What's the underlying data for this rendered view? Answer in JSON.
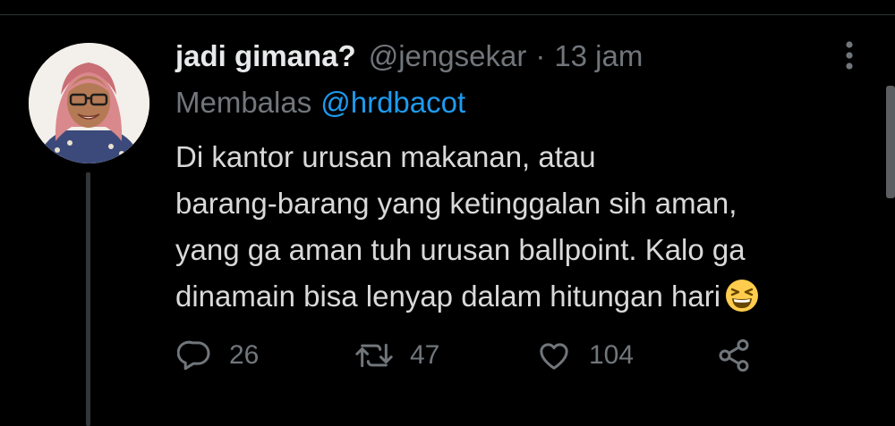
{
  "tweet": {
    "display_name": "jadi gimana?",
    "handle": "@jengsekar",
    "separator": "·",
    "time": "13 jam",
    "reply_prefix": "Membalas",
    "reply_to": "@hrdbacot",
    "text_lines": [
      "Di kantor urusan makanan, atau",
      "barang-barang yang ketinggalan sih aman,",
      "yang ga aman tuh urusan ballpoint. Kalo ga",
      "dinamain bisa lenyap dalam hitungan hari"
    ],
    "emoji": "grinning-squinting-face",
    "stats": {
      "replies": "26",
      "retweets": "47",
      "likes": "104"
    }
  },
  "icons": {
    "more": "more-vertical-icon",
    "reply": "reply-icon",
    "retweet": "retweet-icon",
    "like": "heart-icon",
    "share": "share-icon"
  },
  "colors": {
    "background": "#000000",
    "primary_text": "#e7e9ea",
    "secondary_text": "#71767b",
    "link": "#1d9bf0"
  }
}
